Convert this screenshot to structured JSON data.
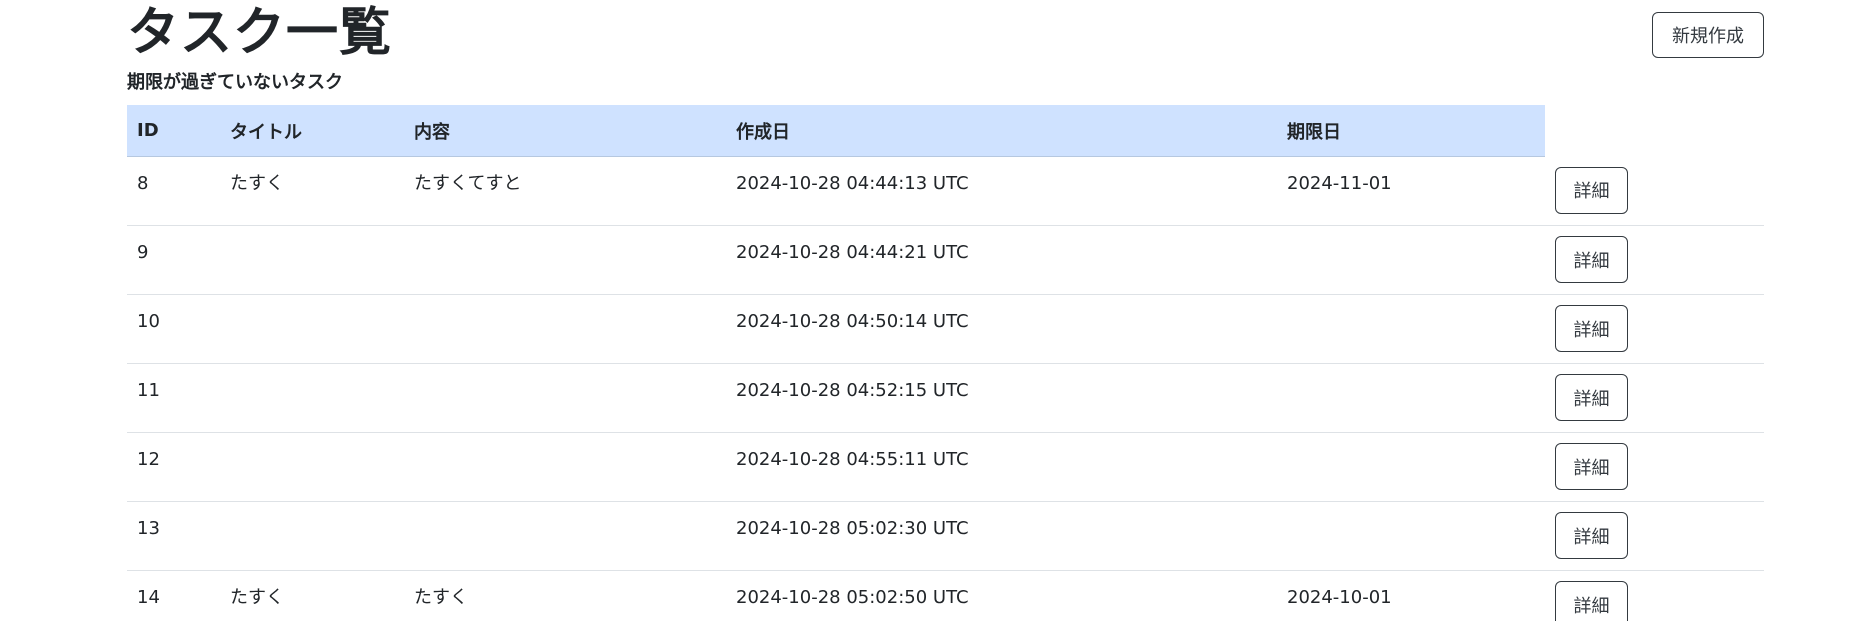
{
  "header": {
    "title": "タスク一覧",
    "new_button_label": "新規作成",
    "subtitle": "期限が過ぎていないタスク"
  },
  "table": {
    "columns": [
      "ID",
      "タイトル",
      "内容",
      "作成日",
      "期限日"
    ],
    "detail_label": "詳細",
    "rows": [
      {
        "id": "8",
        "title": "たすく",
        "content": "たすくてすと",
        "created": "2024-10-28 04:44:13 UTC",
        "due": "2024-11-01"
      },
      {
        "id": "9",
        "title": "",
        "content": "",
        "created": "2024-10-28 04:44:21 UTC",
        "due": ""
      },
      {
        "id": "10",
        "title": "",
        "content": "",
        "created": "2024-10-28 04:50:14 UTC",
        "due": ""
      },
      {
        "id": "11",
        "title": "",
        "content": "",
        "created": "2024-10-28 04:52:15 UTC",
        "due": ""
      },
      {
        "id": "12",
        "title": "",
        "content": "",
        "created": "2024-10-28 04:55:11 UTC",
        "due": ""
      },
      {
        "id": "13",
        "title": "",
        "content": "",
        "created": "2024-10-28 05:02:30 UTC",
        "due": ""
      },
      {
        "id": "14",
        "title": "たすく",
        "content": "たすく",
        "created": "2024-10-28 05:02:50 UTC",
        "due": "2024-10-01"
      }
    ]
  },
  "colors": {
    "header_row_bg": "#cfe2ff",
    "text": "#212529",
    "button_border": "#343a40",
    "row_divider": "#dee2e6"
  }
}
